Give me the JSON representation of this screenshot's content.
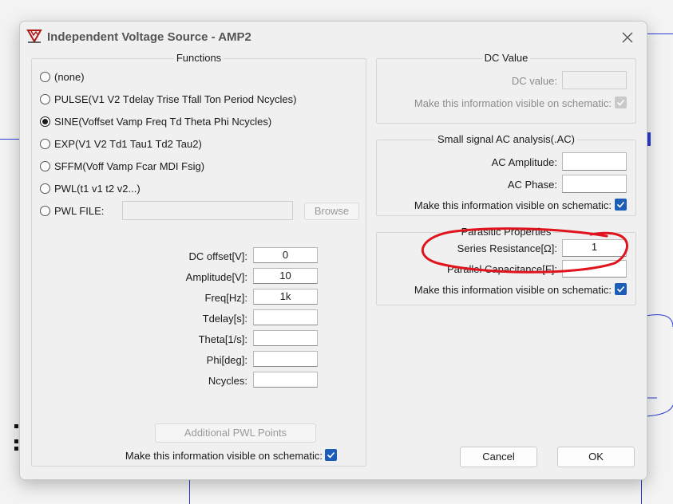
{
  "dialog": {
    "title": "Independent Voltage Source - AMP2"
  },
  "functions": {
    "group_title": "Functions",
    "options": [
      {
        "label": "(none)",
        "selected": false
      },
      {
        "label": "PULSE(V1 V2 Tdelay Trise Tfall Ton Period Ncycles)",
        "selected": false
      },
      {
        "label": "SINE(Voffset Vamp Freq Td Theta Phi Ncycles)",
        "selected": true
      },
      {
        "label": "EXP(V1 V2 Td1 Tau1 Td2 Tau2)",
        "selected": false
      },
      {
        "label": "SFFM(Voff Vamp Fcar MDI Fsig)",
        "selected": false
      },
      {
        "label": "PWL(t1 v1 t2 v2...)",
        "selected": false
      },
      {
        "label": "PWL FILE:",
        "selected": false
      }
    ],
    "pwl_file_value": "",
    "browse_label": "Browse",
    "params": [
      {
        "label": "DC offset[V]:",
        "value": "0"
      },
      {
        "label": "Amplitude[V]:",
        "value": "10"
      },
      {
        "label": "Freq[Hz]:",
        "value": "1k"
      },
      {
        "label": "Tdelay[s]:",
        "value": ""
      },
      {
        "label": "Theta[1/s]:",
        "value": ""
      },
      {
        "label": "Phi[deg]:",
        "value": ""
      },
      {
        "label": "Ncycles:",
        "value": ""
      }
    ],
    "additional_pwl_label": "Additional PWL Points",
    "visible_label": "Make this information visible on schematic:",
    "visible_checked": true
  },
  "dc_value": {
    "group_title": "DC Value",
    "label": "DC value:",
    "value": "",
    "visible_label": "Make this information visible on schematic:",
    "visible_checked": true
  },
  "ac": {
    "group_title": "Small signal AC analysis(.AC)",
    "amplitude_label": "AC Amplitude:",
    "amplitude_value": "",
    "phase_label": "AC Phase:",
    "phase_value": "",
    "visible_label": "Make this information visible on schematic:",
    "visible_checked": true
  },
  "parasitic": {
    "group_title": "Parasitic Properties",
    "series_label": "Series Resistance[Ω]:",
    "series_value": "1",
    "parallel_label": "Parallel Capacitance[F]:",
    "parallel_value": "",
    "visible_label": "Make this information visible on schematic:",
    "visible_checked": true
  },
  "buttons": {
    "cancel": "Cancel",
    "ok": "OK"
  },
  "colors": {
    "accent": "#1c5db8",
    "annotation": "#e0141c",
    "schematic_wire": "#2b3bd6"
  }
}
